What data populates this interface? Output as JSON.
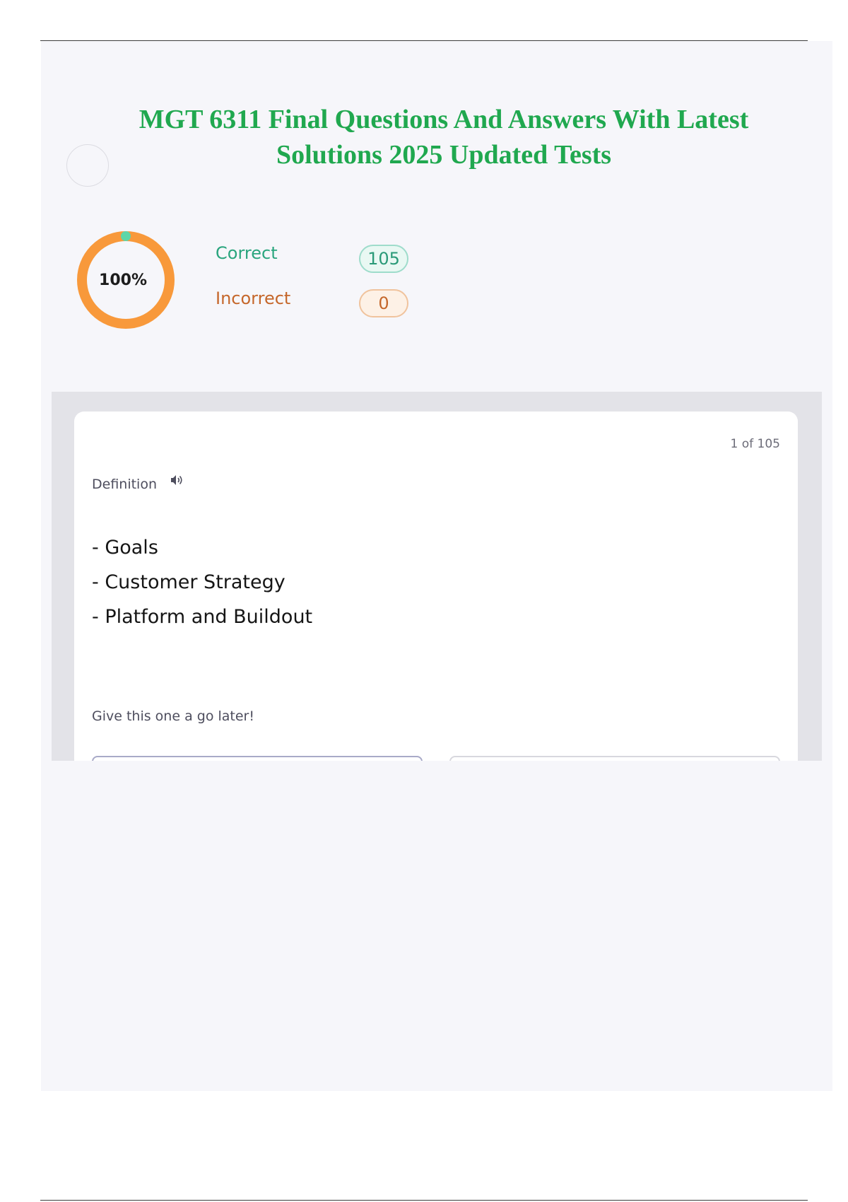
{
  "header": {
    "title": "MGT 6311 Final Questions And Answers With Latest Solutions 2025 Updated Tests"
  },
  "score": {
    "percent_label": "100%",
    "percent_value": 1.0,
    "correct_label": "Correct",
    "correct_count": "105",
    "incorrect_label": "Incorrect",
    "incorrect_count": "0"
  },
  "card": {
    "counter": "1 of 105",
    "type_label": "Definition",
    "definition_items": [
      "- Goals",
      "- Customer Strategy",
      "- Platform and Buildout"
    ],
    "later_link": "Give this one a go later!"
  },
  "colors": {
    "title": "#20a84f",
    "ring": "#f8993b",
    "ring_marker": "#5dd6a8",
    "correct": "#2aa57e",
    "incorrect": "#c5672b"
  },
  "icons": {
    "audio": "speaker-icon"
  }
}
